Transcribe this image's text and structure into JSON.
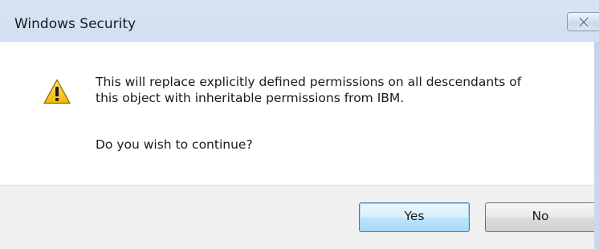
{
  "window": {
    "title": "Windows Security"
  },
  "icons": {
    "warning": "warning-icon",
    "close": "close-icon"
  },
  "dialog": {
    "message_line1": "This will replace explicitly defined permissions on all descendants of",
    "message_line2": "this object with inheritable permissions from IBM.",
    "question": "Do you wish to continue?"
  },
  "buttons": {
    "yes_label": "Yes",
    "no_label": "No",
    "default": "Yes"
  },
  "colors": {
    "title_bar": "#cad9ee",
    "content_bg": "#ffffff",
    "footer_bg": "#f0f0f0",
    "warning_fill": "#f5c518",
    "default_button_border": "#3c7fb1"
  }
}
